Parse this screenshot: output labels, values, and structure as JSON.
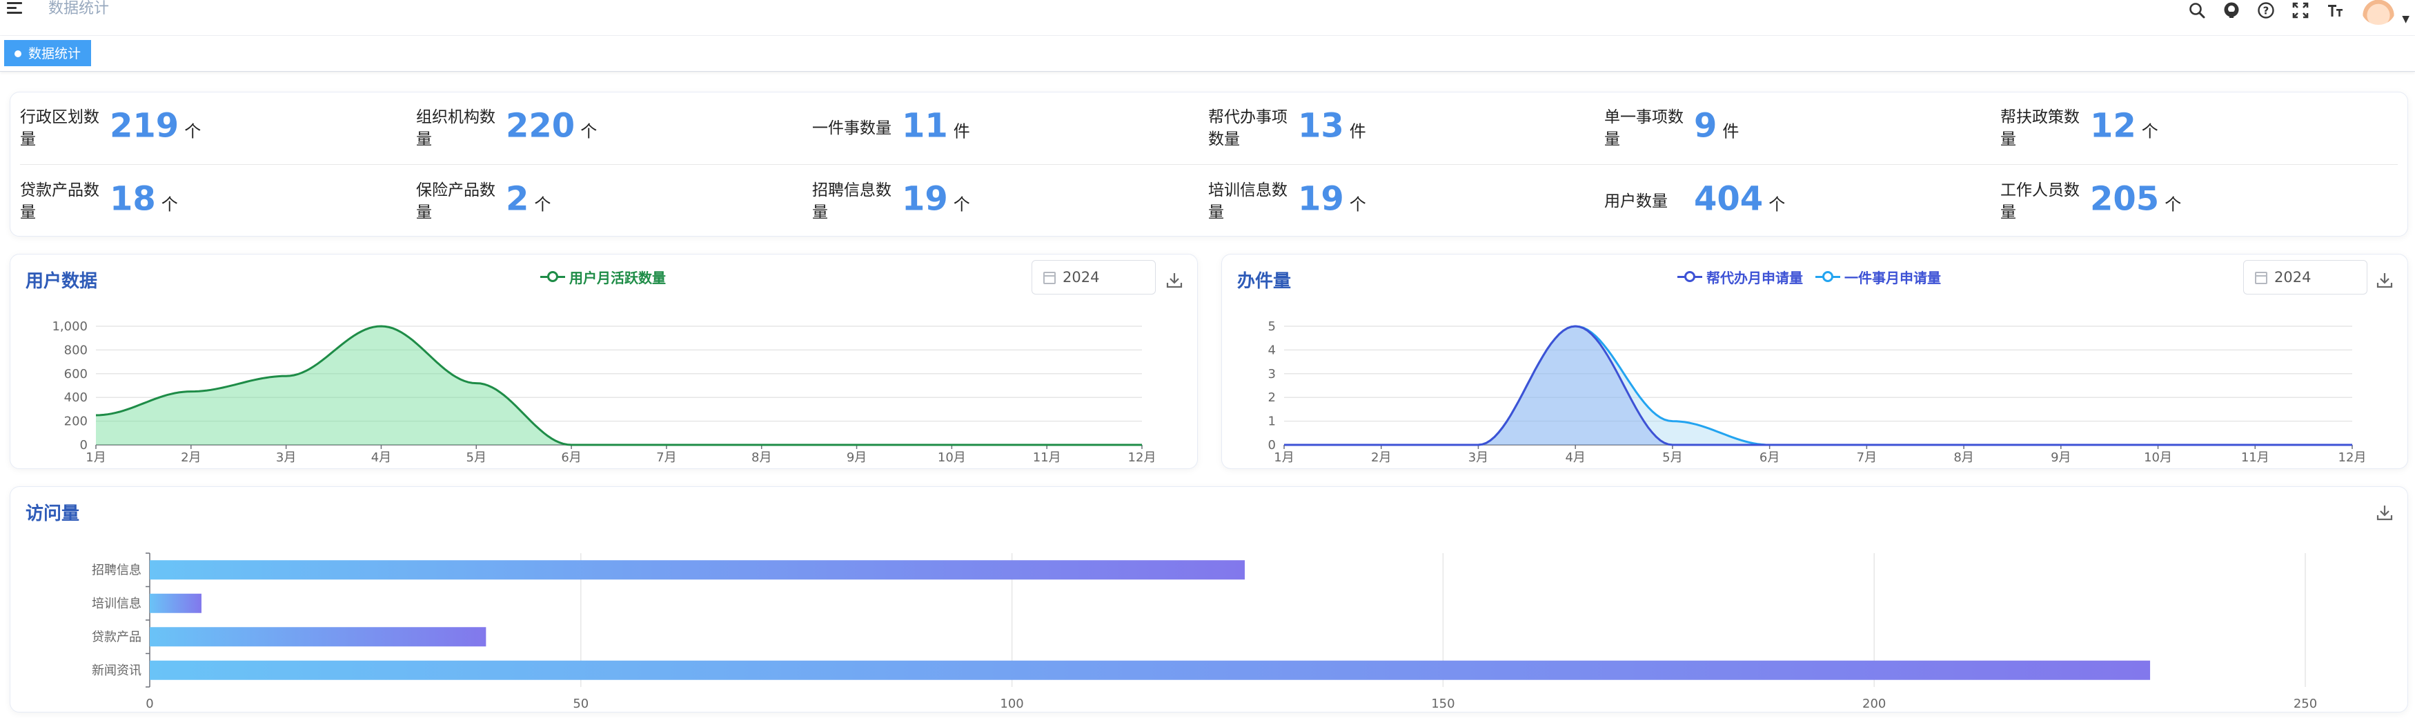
{
  "header": {
    "breadcrumb": "数据统计",
    "icons": [
      "search-icon",
      "github-icon",
      "help-icon",
      "fullscreen-icon",
      "font-size-icon",
      "avatar",
      "caret-down-icon"
    ]
  },
  "tags": [
    {
      "label": "数据统计",
      "active": true
    }
  ],
  "colors": {
    "primary": "#42a0f5",
    "stat_value": "#4a8fe8",
    "title": "#2e5bb8",
    "user_series": "#1e8c47",
    "helper_series": "#3d52d5",
    "oneitem_series": "#23a4f0"
  },
  "stats": [
    {
      "label": "行政区划数量",
      "value": "219",
      "unit": "个"
    },
    {
      "label": "组织机构数量",
      "value": "220",
      "unit": "个"
    },
    {
      "label": "一件事数量",
      "value": "11",
      "unit": "件"
    },
    {
      "label": "帮代办事项数量",
      "value": "13",
      "unit": "件"
    },
    {
      "label": "单一事项数量",
      "value": "9",
      "unit": "件"
    },
    {
      "label": "帮扶政策数量",
      "value": "12",
      "unit": "个"
    },
    {
      "label": "贷款产品数量",
      "value": "18",
      "unit": "个"
    },
    {
      "label": "保险产品数量",
      "value": "2",
      "unit": "个"
    },
    {
      "label": "招聘信息数量",
      "value": "19",
      "unit": "个"
    },
    {
      "label": "培训信息数量",
      "value": "19",
      "unit": "个"
    },
    {
      "label": "用户数量",
      "value": "404",
      "unit": "个"
    },
    {
      "label": "工作人员数量",
      "value": "205",
      "unit": "个"
    }
  ],
  "user_panel": {
    "title": "用户数据",
    "year": "2024"
  },
  "work_panel": {
    "title": "办件量",
    "year": "2024"
  },
  "visit_panel": {
    "title": "访问量"
  },
  "chart_data": [
    {
      "type": "area",
      "title": "用户数据",
      "x": [
        "1月",
        "2月",
        "3月",
        "4月",
        "5月",
        "6月",
        "7月",
        "8月",
        "9月",
        "10月",
        "11月",
        "12月"
      ],
      "series": [
        {
          "name": "用户月活跃数量",
          "values": [
            250,
            450,
            580,
            1000,
            520,
            0,
            0,
            0,
            0,
            0,
            0,
            0
          ]
        }
      ],
      "yticks": [
        "0",
        "200",
        "400",
        "600",
        "800",
        "1,000"
      ],
      "ylim": [
        0,
        1000
      ],
      "grid": true,
      "legend": "top-center"
    },
    {
      "type": "area",
      "title": "办件量",
      "x": [
        "1月",
        "2月",
        "3月",
        "4月",
        "5月",
        "6月",
        "7月",
        "8月",
        "9月",
        "10月",
        "11月",
        "12月"
      ],
      "series": [
        {
          "name": "帮代办月申请量",
          "values": [
            0,
            0,
            0,
            5,
            0,
            0,
            0,
            0,
            0,
            0,
            0,
            0
          ]
        },
        {
          "name": "一件事月申请量",
          "values": [
            0,
            0,
            0,
            5,
            1,
            0,
            0,
            0,
            0,
            0,
            0,
            0
          ]
        }
      ],
      "yticks": [
        "0",
        "1",
        "2",
        "3",
        "4",
        "5"
      ],
      "ylim": [
        0,
        5
      ],
      "grid": true,
      "legend": "top-center"
    },
    {
      "type": "bar",
      "title": "访问量",
      "orientation": "horizontal",
      "categories": [
        "招聘信息",
        "培训信息",
        "贷款产品",
        "新闻资讯"
      ],
      "values": [
        127,
        6,
        39,
        232
      ],
      "xticks": [
        "0",
        "50",
        "100",
        "150",
        "200",
        "250"
      ],
      "xlim": [
        0,
        250
      ],
      "grid": true
    }
  ]
}
